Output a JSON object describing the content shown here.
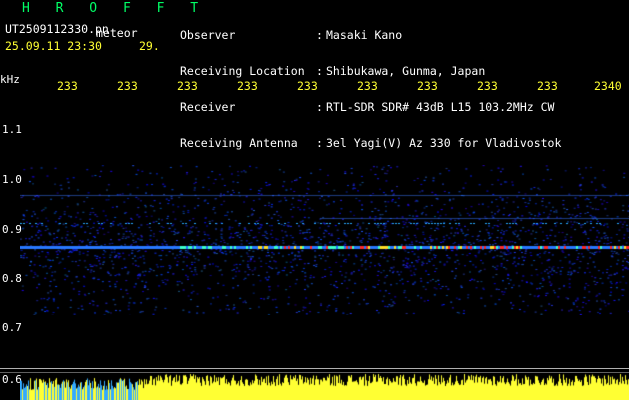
{
  "header": {
    "title": "H R O F F T",
    "filename": "UT2509112330.pn",
    "filename_suffix": "meteor",
    "datetime": "25.09.11 23:30",
    "datetime_num": "29.",
    "labels": [
      "Observer",
      "Receiving Location",
      "Receiver",
      "Receiving Antenna"
    ],
    "colons": [
      ":",
      ":",
      ":",
      ":"
    ],
    "values": [
      "Masaki Kano",
      "Shibukawa, Gunma, Japan",
      "RTL-SDR SDR# 43dB L15 103.2MHz CW",
      "3el Yagi(V) Az 330 for Vladivostok"
    ]
  },
  "axis": {
    "y_unit": "kHz",
    "y_ticks": [
      "1.1",
      "1.0",
      "0.9",
      "0.8",
      "0.7",
      "0.6"
    ],
    "x_ticks": [
      "233",
      "233",
      "233",
      "233",
      "233",
      "233",
      "233",
      "233",
      "233",
      "2340"
    ]
  },
  "colors": {
    "text_white": "#ffffff",
    "accent_green": "#00ff66",
    "accent_yellow": "#ffff33",
    "signal_blue": "#1e3cff",
    "signal_red": "#ff2020"
  },
  "spectrogram": {
    "signal_band_khz": 0.87,
    "noise_band_khz": [
      0.8,
      1.0
    ]
  }
}
